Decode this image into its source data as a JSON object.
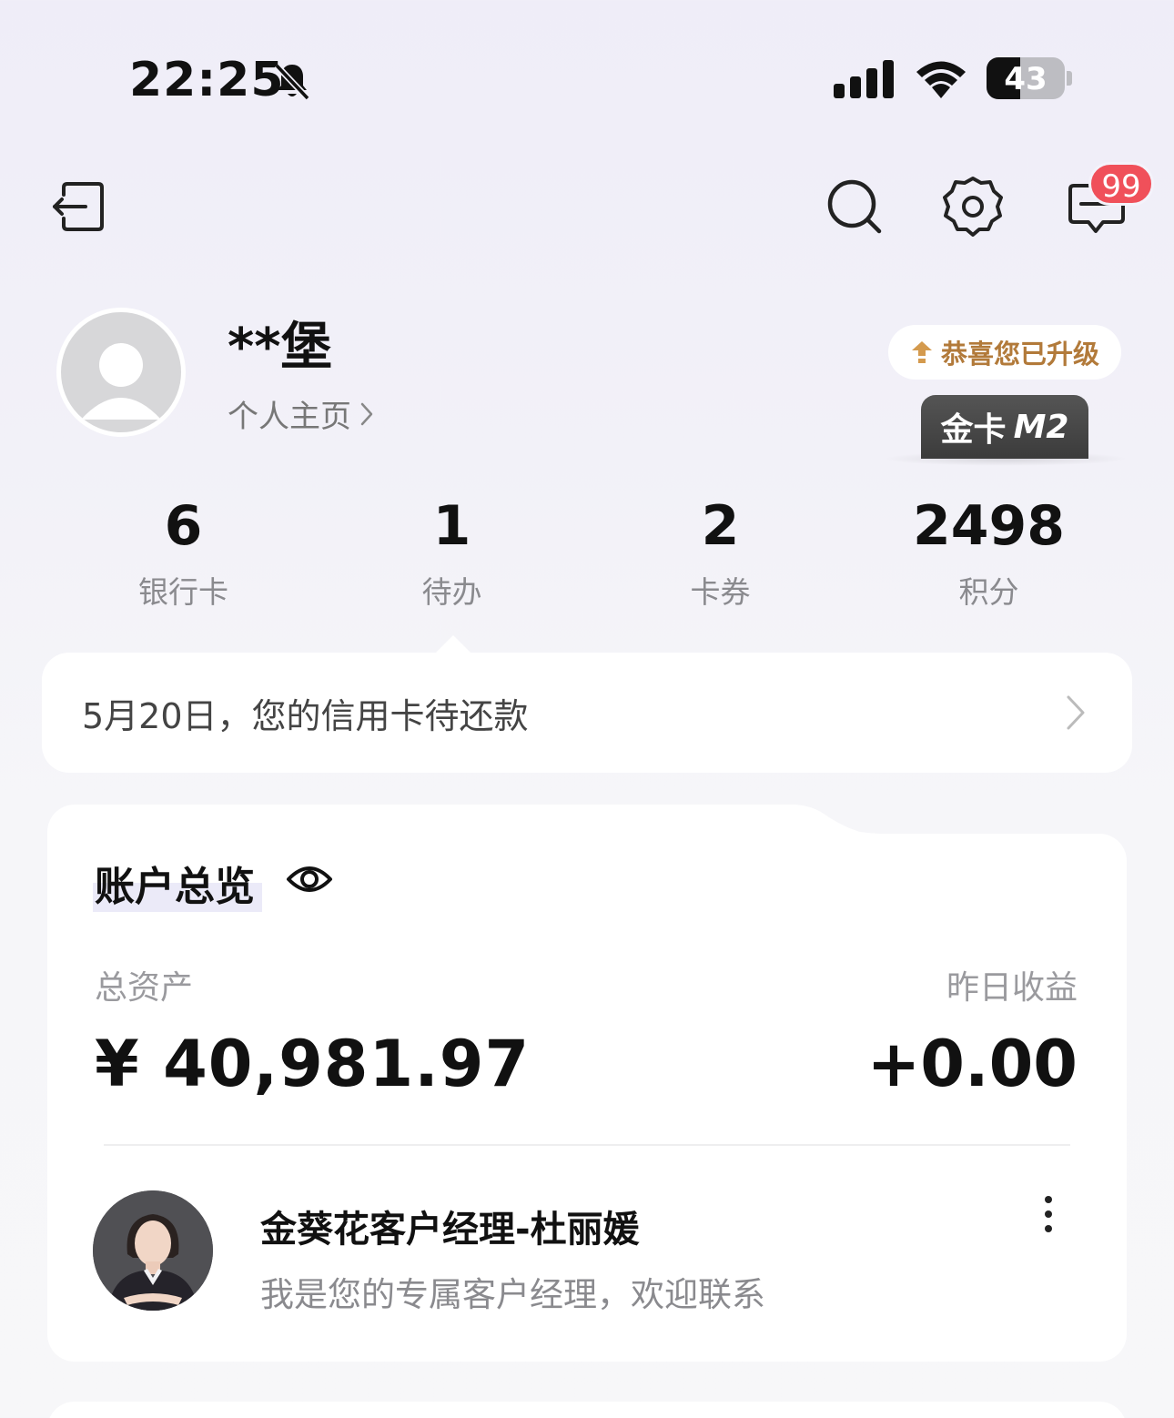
{
  "status_bar": {
    "time": "22:25",
    "battery_level": "43",
    "battery_fraction": 0.43,
    "icons": [
      "bell-muted-icon",
      "cellular-signal-icon",
      "wifi-icon",
      "battery-icon"
    ]
  },
  "header": {
    "icons": [
      "logout-icon",
      "search-icon",
      "gear-icon",
      "message-icon"
    ],
    "message_badge": "99"
  },
  "profile": {
    "name": "**堡",
    "homepage_link": "个人主页",
    "upgrade_text": "恭喜您已升级",
    "card_level_prefix": "金卡",
    "card_level_code": "M2"
  },
  "stats": [
    {
      "value": "6",
      "label": "银行卡"
    },
    {
      "value": "1",
      "label": "待办"
    },
    {
      "value": "2",
      "label": "卡券"
    },
    {
      "value": "2498",
      "label": "积分"
    }
  ],
  "notice": {
    "text": "5月20日，您的信用卡待还款"
  },
  "account": {
    "title": "账户总览",
    "total_assets_label": "总资产",
    "total_assets_value": "¥ 40,981.97",
    "yesterday_income_label": "昨日收益",
    "yesterday_income_value": "+0.00"
  },
  "manager": {
    "name": "金葵花客户经理-杜丽媛",
    "description": "我是您的专属客户经理，欢迎联系"
  },
  "colors": {
    "accent_gold": "#b27a3a",
    "badge_red": "#f0505a",
    "card_dark": "#444444"
  }
}
